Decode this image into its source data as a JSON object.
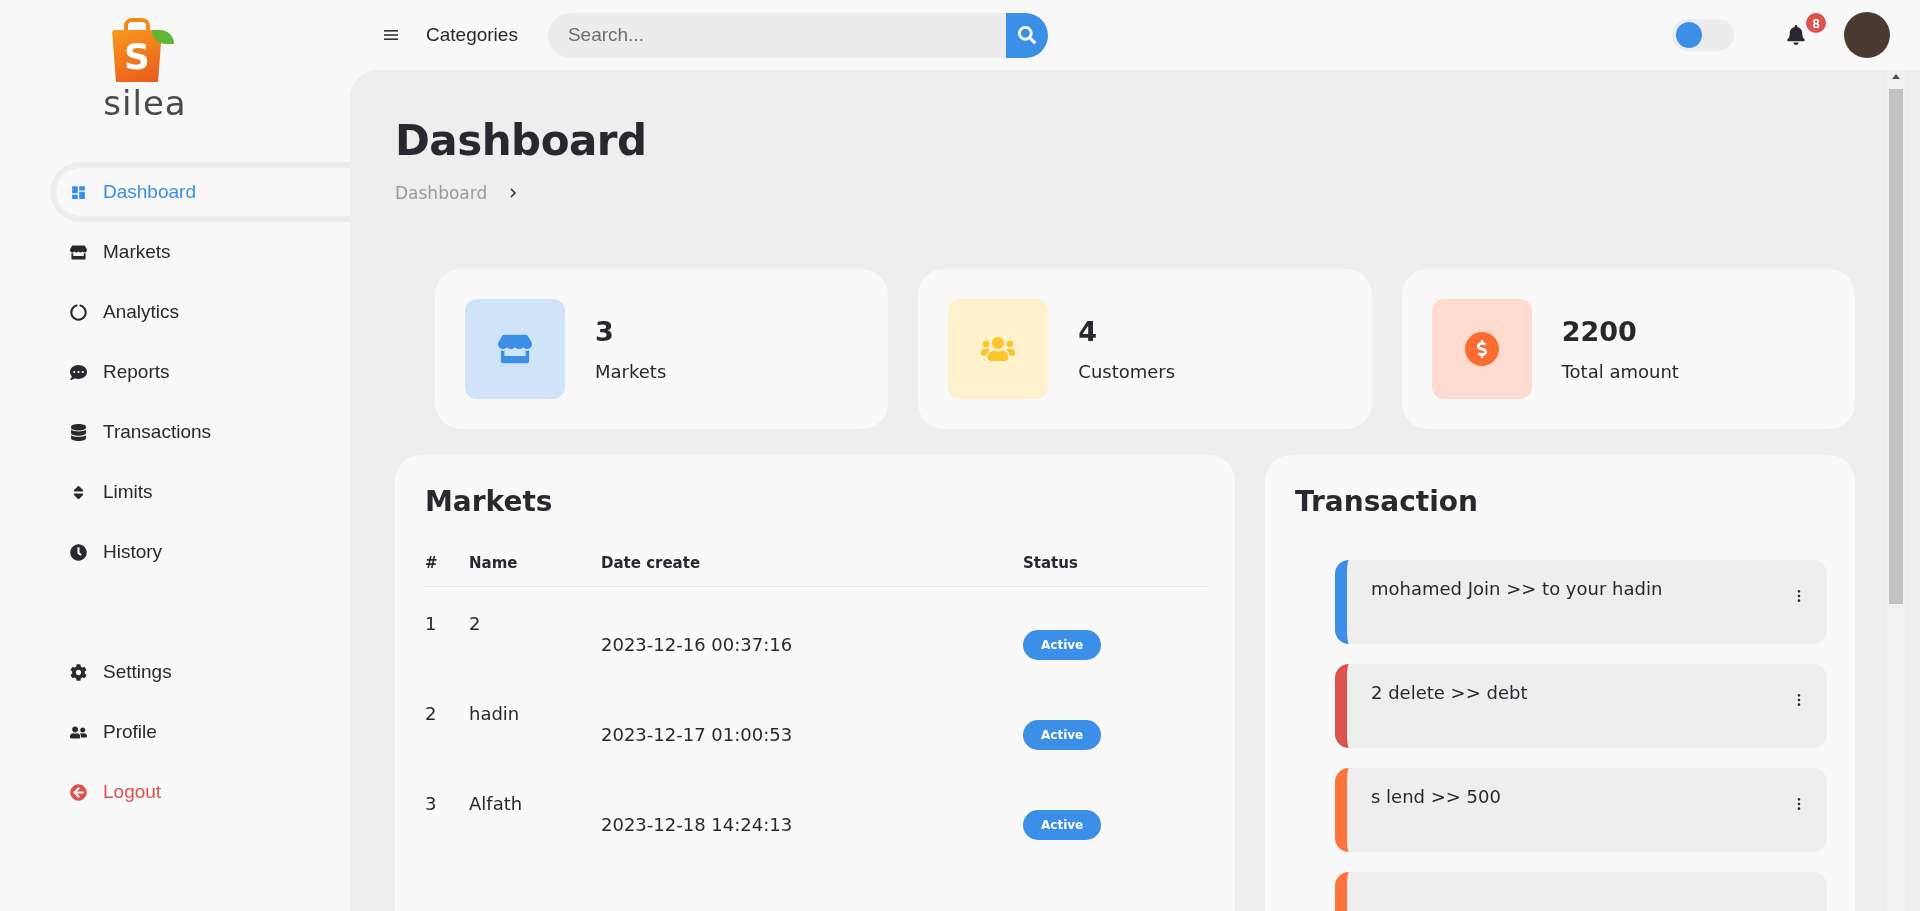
{
  "logo": {
    "mark": "S",
    "name": "silea"
  },
  "sidebar": {
    "items": [
      {
        "label": "Dashboard",
        "selected": true,
        "kind": "link"
      },
      {
        "label": "Markets",
        "selected": false,
        "kind": "link"
      },
      {
        "label": "Analytics",
        "selected": false,
        "kind": "link"
      },
      {
        "label": "Reports",
        "selected": false,
        "kind": "link"
      },
      {
        "label": "Transactions",
        "selected": false,
        "kind": "link"
      },
      {
        "label": "Limits",
        "selected": false,
        "kind": "link"
      },
      {
        "label": "History",
        "selected": false,
        "kind": "link"
      }
    ],
    "bottom_items": [
      {
        "label": "Settings",
        "selected": false,
        "kind": "link"
      },
      {
        "label": "Profile",
        "selected": false,
        "kind": "link"
      },
      {
        "label": "Logout",
        "selected": false,
        "kind": "danger"
      }
    ]
  },
  "header": {
    "menu_label": "Categories",
    "search": {
      "placeholder": "Search..."
    },
    "theme_toggle": {
      "on": false
    },
    "notifications": {
      "count": "8"
    }
  },
  "page": {
    "title": "Dashboard",
    "breadcrumb": [
      "Dashboard"
    ]
  },
  "stats": [
    {
      "value": "3",
      "label": "Markets",
      "color": "#3b8fe6"
    },
    {
      "value": "4",
      "label": "Customers",
      "color": "#fcc52b"
    },
    {
      "value": "2200",
      "label": "Total amount",
      "color": "#fb6b32"
    }
  ],
  "markets": {
    "title": "Markets",
    "columns": [
      "#",
      "Name",
      "Date create",
      "Status"
    ],
    "rows": [
      {
        "index": "1",
        "name": "2",
        "date": "2023-12-16 00:37:16",
        "status": "Active"
      },
      {
        "index": "2",
        "name": "hadin",
        "date": "2023-12-17 01:00:53",
        "status": "Active"
      },
      {
        "index": "3",
        "name": "Alfath",
        "date": "2023-12-18 14:24:13",
        "status": "Active"
      }
    ]
  },
  "transactions": {
    "title": "Transaction",
    "items": [
      {
        "text": "mohamed Join >> to your hadin",
        "color": "#3b8fe6"
      },
      {
        "text": "2 delete >> debt",
        "color": "#dc524f"
      },
      {
        "text": "s lend >> 500",
        "color": "#fe733a"
      },
      {
        "color": "#fe733a"
      }
    ]
  }
}
